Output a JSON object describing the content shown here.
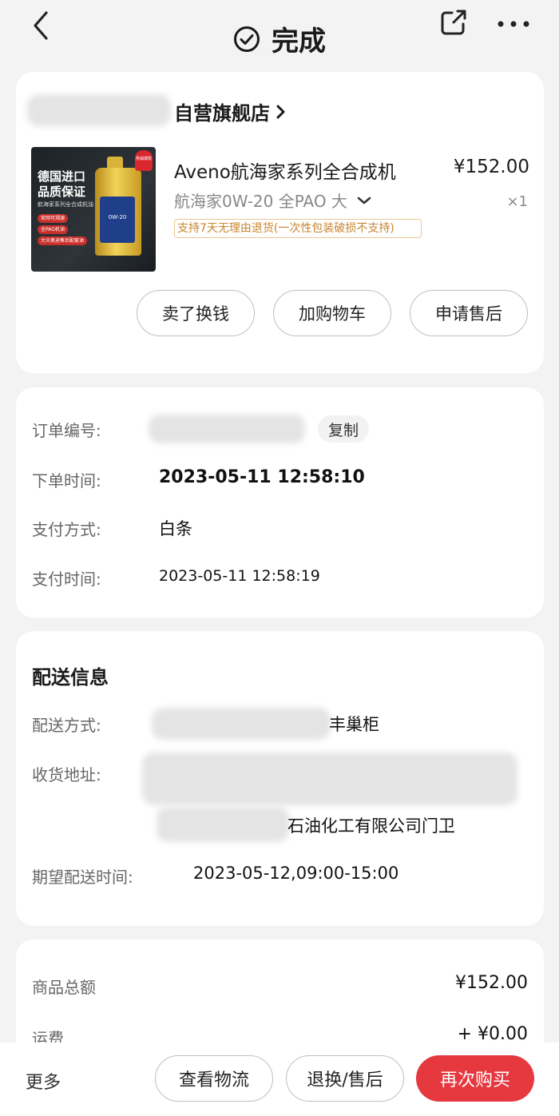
{
  "header": {
    "title": "完成"
  },
  "shop": {
    "name": "自营旗舰店"
  },
  "product": {
    "name": "Aveno航海家系列全合成机",
    "price": "¥152.00",
    "spec": "航海家0W-20 全PAO 大",
    "qty": "×1",
    "return_policy": "支持7天无理由退货(一次性包装破损不支持)",
    "image_text_line1": "德国进口",
    "image_text_line2": "品质保证",
    "image_subtitle": "航海家系列全合成机油",
    "image_tag1": "官网可溯源",
    "image_tag2": "全PAO机油",
    "image_tag3": "大众奥迪售后配套油",
    "bottle_label": "0W-20",
    "badge_text": "热销爆款"
  },
  "product_actions": {
    "sell": "卖了换钱",
    "add_cart": "加购物车",
    "after_sales": "申请售后"
  },
  "order_info": {
    "order_no_label": "订单编号:",
    "copy_label": "复制",
    "order_time_label": "下单时间:",
    "order_time": "2023-05-11 12:58:10",
    "pay_method_label": "支付方式:",
    "pay_method": "白条",
    "pay_time_label": "支付时间:",
    "pay_time": "2023-05-11 12:58:19"
  },
  "delivery": {
    "title": "配送信息",
    "method_label": "配送方式:",
    "method_value_visible": "丰巢柜",
    "address_label": "收货地址:",
    "address_value_visible": "石油化工有限公司门卫",
    "expected_label": "期望配送时间:",
    "expected_value": "2023-05-12,09:00-15:00"
  },
  "amounts": {
    "total_label": "商品总额",
    "total_value": "¥152.00",
    "shipping_label": "运费",
    "shipping_value": "+ ¥0.00"
  },
  "bottom_bar": {
    "more": "更多",
    "logistics": "查看物流",
    "return_exchange": "退换/售后",
    "buy_again": "再次购买"
  },
  "colors": {
    "primary_red": "#e5383f",
    "policy_orange": "#c7852e",
    "page_bg": "#f3f3f3"
  }
}
